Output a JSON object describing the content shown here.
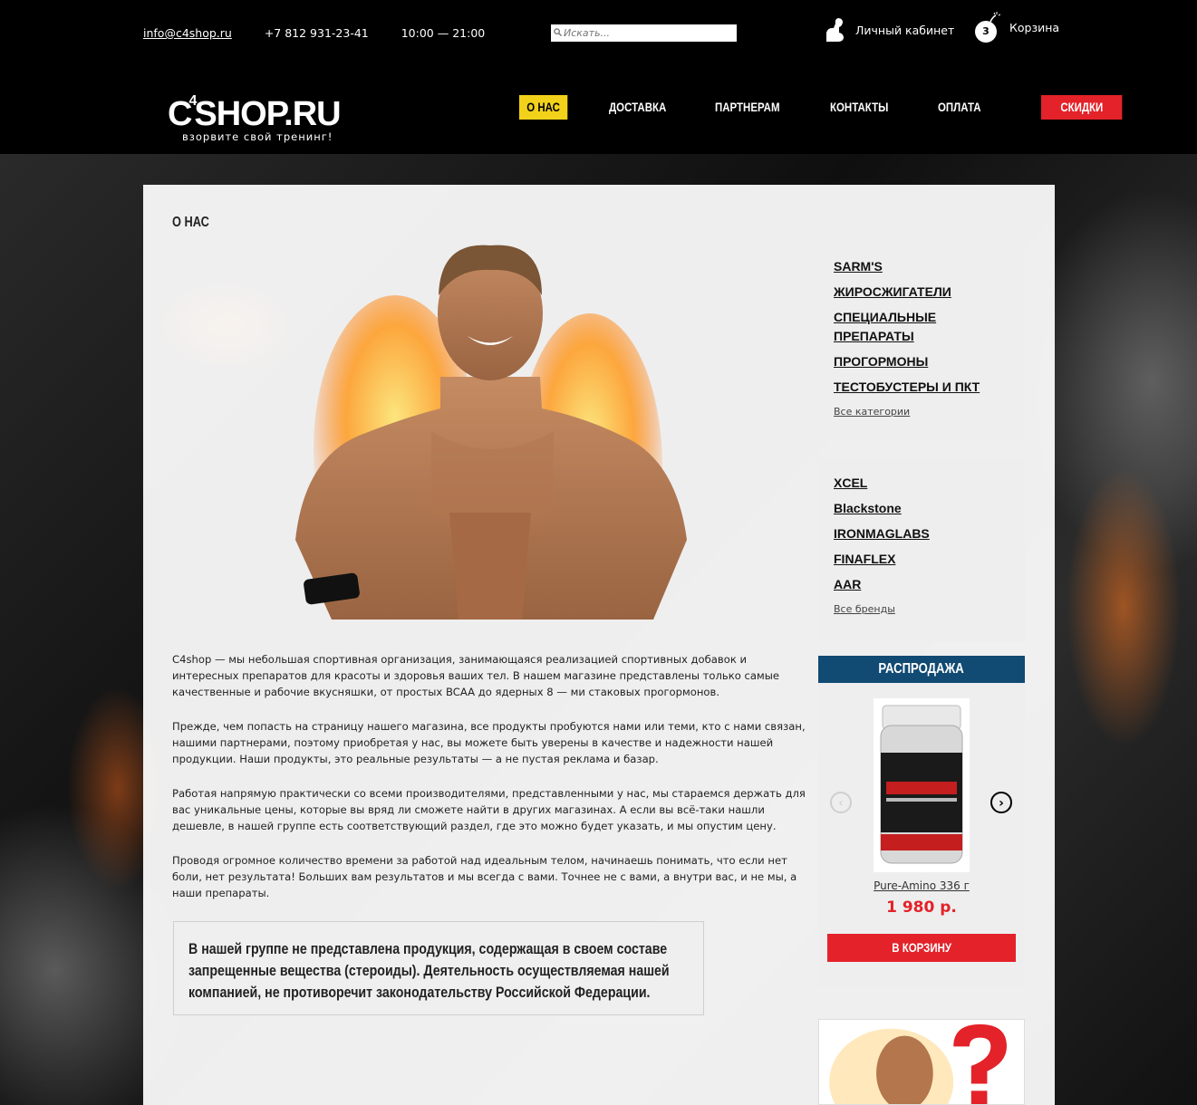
{
  "header": {
    "email": "info@c4shop.ru",
    "phone": "+7 812 931-23-41",
    "hours": "10:00 — 21:00",
    "search_placeholder": "Искать...",
    "account_label": "Личный кабинет",
    "cart_label": "Корзина",
    "cart_count": "3"
  },
  "logo": {
    "brand_left": "C",
    "brand_sup": "4",
    "brand_right": "SHOP.RU",
    "tagline": "взорвите свой тренинг!"
  },
  "nav": {
    "items": [
      "О НАС",
      "ДОСТАВКА",
      "ПАРТНЕРАМ",
      "КОНТАКТЫ",
      "ОПЛАТА",
      "СКИДКИ"
    ]
  },
  "page": {
    "title": "О НАС",
    "paragraphs": [
      "C4shop — мы небольшая спортивная организация, занимающаяся реализацией спортивных добавок и интересных препаратов для красоты и здоровья ваших тел. В нашем магазине представлены только самые качественные и рабочие вкусняшки, от простых BCAA до ядерных 8 — ми стаковых прогормонов.",
      "Прежде, чем попасть на страницу нашего магазина, все продукты пробуются нами или теми, кто с нами связан, нашими партнерами, поэтому приобретая у нас, вы можете быть уверены в качестве и надежности нашей продукции. Наши продукты, это реальные результаты — а не пустая реклама и базар.",
      "Работая напрямую практически со всеми производителями, представленными у нас, мы стараемся держать для вас уникальные цены, которые вы вряд ли сможете найти в других магазинах. А если вы всё-таки нашли дешевле, в нашей группе есть соответствующий раздел, где это можно будет указать, и мы опустим цену.",
      "Проводя огромное количество времени за работой над идеальным телом, начинаешь понимать, что если нет боли, нет результата! Больших вам результатов и мы всегда с вами. Точнее не с вами, а внутри вас, и не мы, а наши препараты."
    ],
    "notice": "В нашей группе не представлена продукция, содержащая в своем составе запрещенные вещества (стероиды). Деятельность осуществляемая нашей компанией, не противоречит законодательству Российской Федерации."
  },
  "sidebar": {
    "categories": [
      "SARM'S",
      "ЖИРОСЖИГАТЕЛИ",
      "СПЕЦИАЛЬНЫЕ ПРЕПАРАТЫ",
      "ПРОГОРМОНЫ",
      "ТЕСТОБУСТЕРЫ И ПКТ"
    ],
    "all_categories": "Все категории",
    "brands": [
      "XCEL",
      "Blackstone",
      "IRONMAGLABS",
      "FINAFLEX",
      "AAR"
    ],
    "all_brands": "Все бренды",
    "sale": {
      "title": "РАСПРОДАЖА",
      "product_name": "Pure-Amino 336 г",
      "price": "1 980 р.",
      "button": "В КОРЗИНУ"
    }
  },
  "colors": {
    "accent_yellow": "#f2d11a",
    "accent_red": "#e32229",
    "sale_header": "#114a72"
  }
}
